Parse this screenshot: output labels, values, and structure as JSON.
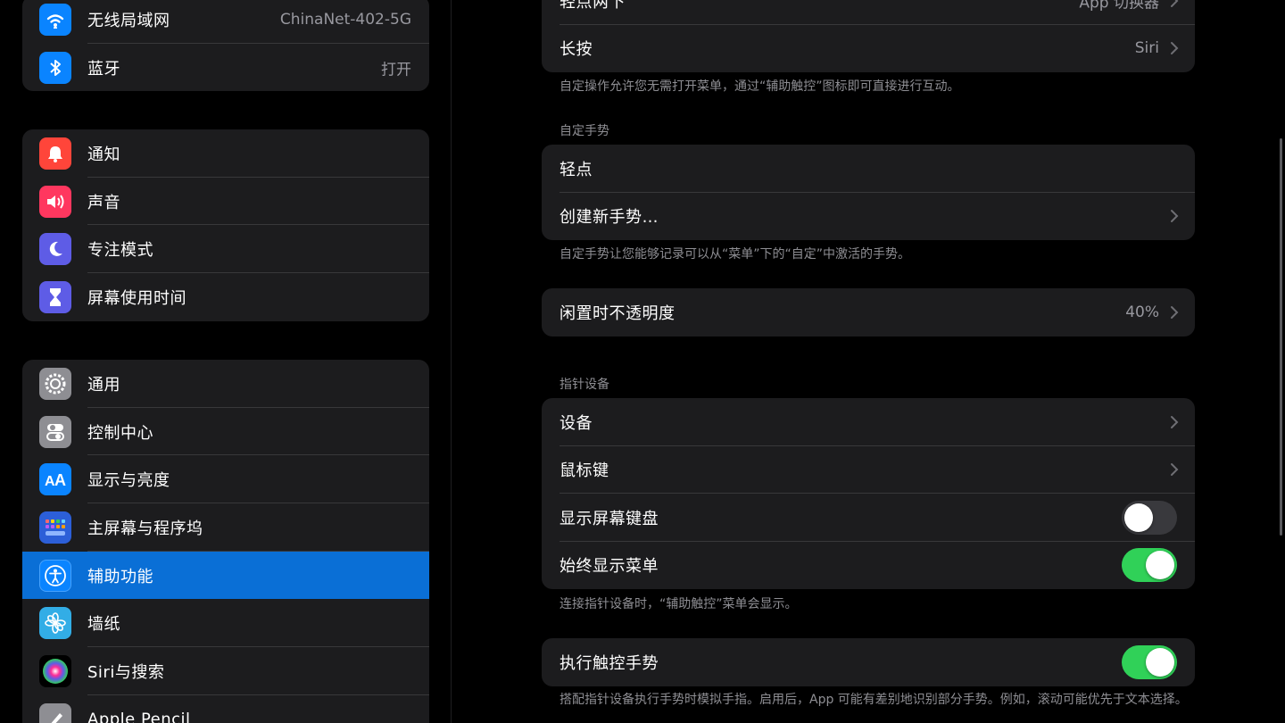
{
  "sidebar": {
    "group1": [
      {
        "label": "无线局域网",
        "value": "ChinaNet-402-5G",
        "icon": "wifi-icon",
        "color": "#0a84ff"
      },
      {
        "label": "蓝牙",
        "value": "打开",
        "icon": "bluetooth-icon",
        "color": "#0a84ff"
      }
    ],
    "group2": [
      {
        "label": "通知",
        "icon": "bell-icon",
        "color": "#ff453a"
      },
      {
        "label": "声音",
        "icon": "speaker-icon",
        "color": "#ff375f"
      },
      {
        "label": "专注模式",
        "icon": "moon-icon",
        "color": "#5e5ce6"
      },
      {
        "label": "屏幕使用时间",
        "icon": "hourglass-icon",
        "color": "#5e5ce6"
      }
    ],
    "group3": [
      {
        "label": "通用",
        "icon": "gear-icon",
        "color": "#8e8e93"
      },
      {
        "label": "控制中心",
        "icon": "toggles-icon",
        "color": "#8e8e93"
      },
      {
        "label": "显示与亮度",
        "icon": "text-size-icon",
        "color": "#0a84ff"
      },
      {
        "label": "主屏幕与程序坞",
        "icon": "home-grid-icon",
        "color": "#2c5fd8"
      },
      {
        "label": "辅助功能",
        "icon": "accessibility-icon",
        "color": "#0a84ff",
        "selected": true
      },
      {
        "label": "墙纸",
        "icon": "flower-icon",
        "color": "#32ade6"
      },
      {
        "label": "Siri与搜索",
        "icon": "siri-icon",
        "color": "#1c1c1e"
      },
      {
        "label": "Apple Pencil",
        "icon": "pencil-icon",
        "color": "#8e8e93"
      }
    ]
  },
  "content": {
    "top_card": [
      {
        "label": "轻点两下",
        "value": "App 切换器"
      },
      {
        "label": "长按",
        "value": "Siri"
      }
    ],
    "top_footnote": "自定操作允许您无需打开菜单，通过“辅助触控”图标即可直接进行互动。",
    "custom_header": "自定手势",
    "custom_card": [
      {
        "label": "轻点"
      },
      {
        "label": "创建新手势…"
      }
    ],
    "custom_footnote": "自定手势让您能够记录可以从“菜单”下的“自定”中激活的手势。",
    "opacity": {
      "label": "闲置时不透明度",
      "value": "40%"
    },
    "pointer_header": "指针设备",
    "pointer_card": [
      {
        "label": "设备"
      },
      {
        "label": "鼠标键"
      },
      {
        "label": "显示屏幕键盘",
        "toggle": false
      },
      {
        "label": "始终显示菜单",
        "toggle": true
      }
    ],
    "pointer_footnote": "连接指针设备时，“辅助触控”菜单会显示。",
    "gesture": {
      "label": "执行触控手势",
      "toggle": true
    },
    "gesture_footnote": "搭配指针设备执行手势时模拟手指。启用后，App 可能有差别地识别部分手势。例如，滚动可能优先于文本选择。"
  }
}
